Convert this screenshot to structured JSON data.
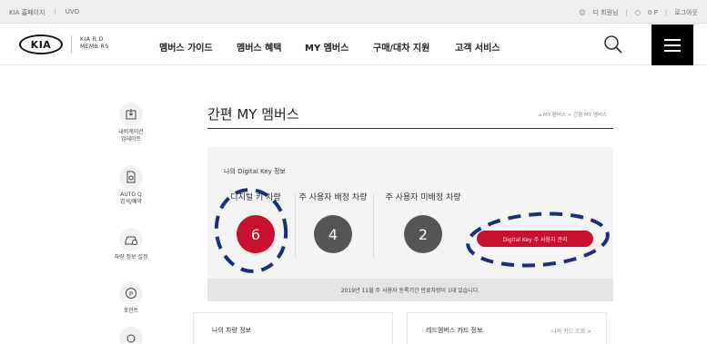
{
  "topbar": {
    "left_links": [
      "KIA 홈페이지",
      "UVO"
    ],
    "separator": "|",
    "user_name": "디 회원님",
    "points": "0 P",
    "logout": "로그아웃"
  },
  "header": {
    "logo_text": "KIA",
    "members_logo_line1": "KIA R D",
    "members_logo_line2": "MEMB RS",
    "nav": [
      "멤버스 가이드",
      "멤버스 혜택",
      "MY 멤버스",
      "구매/대차 지원",
      "고객 서비스"
    ]
  },
  "sidebar": {
    "items": [
      {
        "label_line1": "내비게이션",
        "label_line2": "업데이트"
      },
      {
        "label_line1": "AUTO Q",
        "label_line2": "검색/예약"
      },
      {
        "label_line1": "차량 정보 설정",
        "label_line2": ""
      },
      {
        "label_line1": "포인트",
        "label_line2": ""
      }
    ]
  },
  "main": {
    "title": "간편 MY 멤버스",
    "breadcrumb": "MY 멤버스 > 간편 MY 멤버스",
    "digital_key": {
      "section_title": "나의 Digital Key 정보",
      "stats": [
        {
          "label": "디지털 키 차량",
          "value": "6",
          "color": "#c8102e"
        },
        {
          "label": "주 사용자 배정 차량",
          "value": "4",
          "color": "#555555"
        },
        {
          "label": "주 사용자 미배정 차량",
          "value": "2",
          "color": "#555555"
        }
      ],
      "manage_button": "Digital Key 주 사용자 관리",
      "notice": "2019년 11월 주 사용자 등록기간 만료차량이 1대 있습니다."
    },
    "my_car": {
      "title": "나의 차량 정보"
    },
    "red_card": {
      "title": "레드멤버스 카드 정보",
      "link": "나의 카드 조회 >"
    }
  },
  "colors": {
    "accent": "#c8102e",
    "annotation": "#1a2e7a"
  }
}
